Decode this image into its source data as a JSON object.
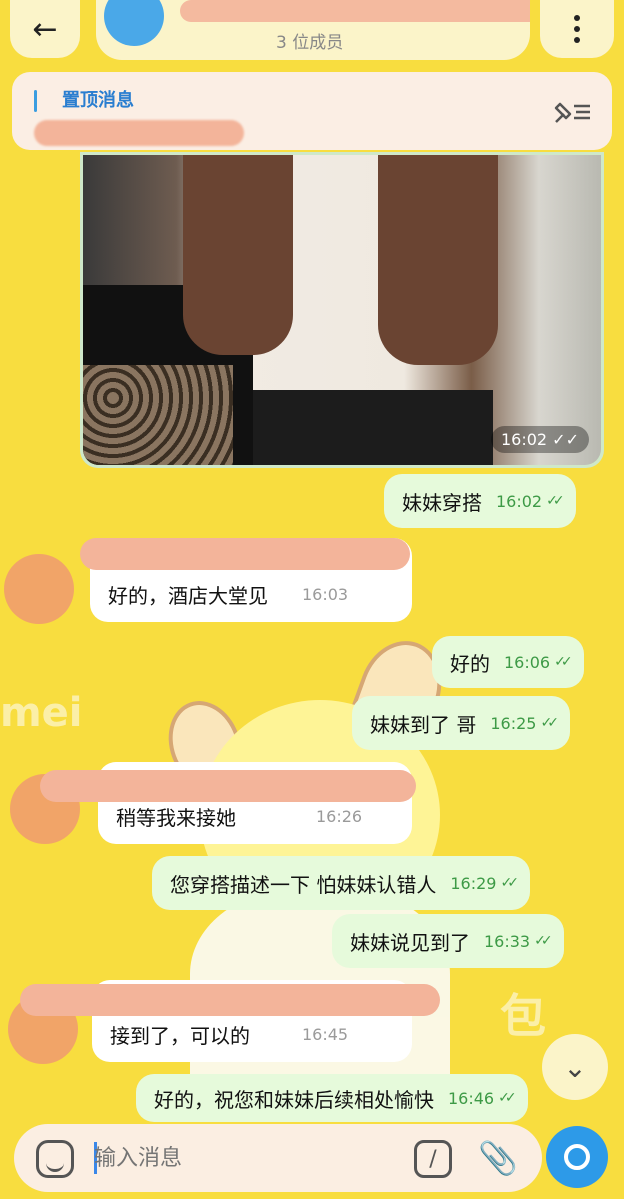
{
  "header": {
    "back_icon": "arrow-left-icon",
    "subtitle": "3 位成员",
    "menu_icon": "more-vert-icon"
  },
  "pinned": {
    "label": "置顶消息",
    "icon": "pin-list-icon"
  },
  "photo": {
    "time": "16:02 ✓✓"
  },
  "messages": [
    {
      "dir": "out",
      "text": "妹妹穿搭",
      "time": "16:02"
    },
    {
      "dir": "in",
      "text": "好的，酒店大堂见",
      "time": "16:03"
    },
    {
      "dir": "out",
      "text": "好的",
      "time": "16:06"
    },
    {
      "dir": "out",
      "text": "妹妹到了 哥",
      "time": "16:25"
    },
    {
      "dir": "in",
      "text": "稍等我来接她",
      "time": "16:26"
    },
    {
      "dir": "out",
      "text": "您穿搭描述一下 怕妹妹认错人",
      "time": "16:29"
    },
    {
      "dir": "out",
      "text": "妹妹说见到了",
      "time": "16:33"
    },
    {
      "dir": "in",
      "text": "接到了，可以的",
      "time": "16:45"
    },
    {
      "dir": "out",
      "text": "好的，祝您和妹妹后续相处愉快",
      "time": "16:46"
    }
  ],
  "composer": {
    "placeholder": "输入消息",
    "emoji_icon": "sticker-icon",
    "command_icon": "slash-command-icon",
    "attach_icon": "paperclip-icon",
    "send_icon": "send-icon"
  },
  "scroll_down_icon": "chevron-down-icon",
  "colors": {
    "background": "#f8dd3f",
    "outgoing_bubble": "#e6fadb",
    "incoming_bubble": "#ffffff",
    "accent": "#2d9ae8",
    "time_green": "#3d9a46"
  }
}
